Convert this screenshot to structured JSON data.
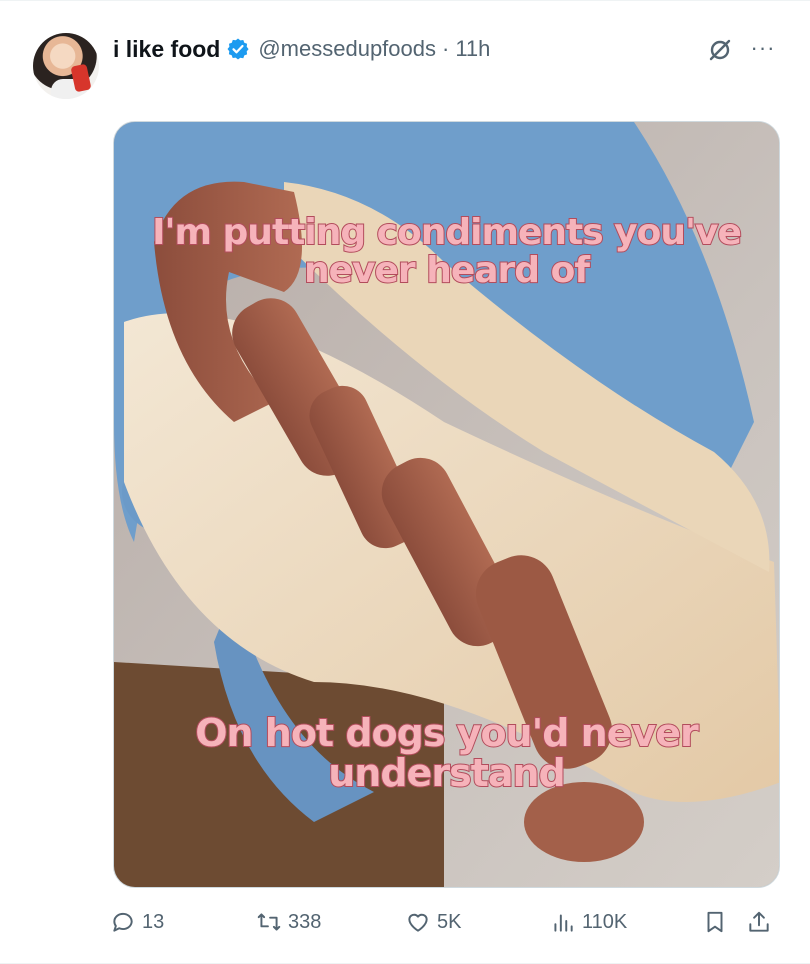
{
  "tweet": {
    "display_name": "i like food",
    "handle": "@messedupfoods",
    "separator": "·",
    "time": "11h",
    "more_label": "···"
  },
  "media": {
    "caption_top_line1": "I'm putting condiments you've",
    "caption_top_line2": "never heard of",
    "caption_bottom_line1": "On hot dogs you'd never",
    "caption_bottom_line2": "understand"
  },
  "actions": {
    "replies": "13",
    "reposts": "338",
    "likes": "5K",
    "views": "110K"
  },
  "icons": {
    "verified": "verified-badge-icon",
    "grok": "grok-icon",
    "more": "more-icon",
    "reply": "reply-icon",
    "repost": "repost-icon",
    "like": "heart-icon",
    "views": "views-chart-icon",
    "bookmark": "bookmark-icon",
    "share": "share-icon"
  },
  "colors": {
    "verified_blue": "#1d9bf0",
    "secondary_text": "#536471",
    "caption_fill": "#f6b3ba",
    "caption_stroke": "#b24c5c"
  }
}
